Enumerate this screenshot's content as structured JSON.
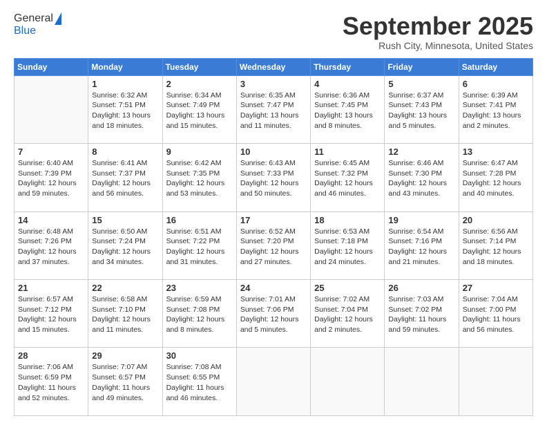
{
  "header": {
    "logo_general": "General",
    "logo_blue": "Blue",
    "month": "September 2025",
    "location": "Rush City, Minnesota, United States"
  },
  "days_of_week": [
    "Sunday",
    "Monday",
    "Tuesday",
    "Wednesday",
    "Thursday",
    "Friday",
    "Saturday"
  ],
  "weeks": [
    [
      {
        "day": "",
        "info": ""
      },
      {
        "day": "1",
        "info": "Sunrise: 6:32 AM\nSunset: 7:51 PM\nDaylight: 13 hours\nand 18 minutes."
      },
      {
        "day": "2",
        "info": "Sunrise: 6:34 AM\nSunset: 7:49 PM\nDaylight: 13 hours\nand 15 minutes."
      },
      {
        "day": "3",
        "info": "Sunrise: 6:35 AM\nSunset: 7:47 PM\nDaylight: 13 hours\nand 11 minutes."
      },
      {
        "day": "4",
        "info": "Sunrise: 6:36 AM\nSunset: 7:45 PM\nDaylight: 13 hours\nand 8 minutes."
      },
      {
        "day": "5",
        "info": "Sunrise: 6:37 AM\nSunset: 7:43 PM\nDaylight: 13 hours\nand 5 minutes."
      },
      {
        "day": "6",
        "info": "Sunrise: 6:39 AM\nSunset: 7:41 PM\nDaylight: 13 hours\nand 2 minutes."
      }
    ],
    [
      {
        "day": "7",
        "info": "Sunrise: 6:40 AM\nSunset: 7:39 PM\nDaylight: 12 hours\nand 59 minutes."
      },
      {
        "day": "8",
        "info": "Sunrise: 6:41 AM\nSunset: 7:37 PM\nDaylight: 12 hours\nand 56 minutes."
      },
      {
        "day": "9",
        "info": "Sunrise: 6:42 AM\nSunset: 7:35 PM\nDaylight: 12 hours\nand 53 minutes."
      },
      {
        "day": "10",
        "info": "Sunrise: 6:43 AM\nSunset: 7:33 PM\nDaylight: 12 hours\nand 50 minutes."
      },
      {
        "day": "11",
        "info": "Sunrise: 6:45 AM\nSunset: 7:32 PM\nDaylight: 12 hours\nand 46 minutes."
      },
      {
        "day": "12",
        "info": "Sunrise: 6:46 AM\nSunset: 7:30 PM\nDaylight: 12 hours\nand 43 minutes."
      },
      {
        "day": "13",
        "info": "Sunrise: 6:47 AM\nSunset: 7:28 PM\nDaylight: 12 hours\nand 40 minutes."
      }
    ],
    [
      {
        "day": "14",
        "info": "Sunrise: 6:48 AM\nSunset: 7:26 PM\nDaylight: 12 hours\nand 37 minutes."
      },
      {
        "day": "15",
        "info": "Sunrise: 6:50 AM\nSunset: 7:24 PM\nDaylight: 12 hours\nand 34 minutes."
      },
      {
        "day": "16",
        "info": "Sunrise: 6:51 AM\nSunset: 7:22 PM\nDaylight: 12 hours\nand 31 minutes."
      },
      {
        "day": "17",
        "info": "Sunrise: 6:52 AM\nSunset: 7:20 PM\nDaylight: 12 hours\nand 27 minutes."
      },
      {
        "day": "18",
        "info": "Sunrise: 6:53 AM\nSunset: 7:18 PM\nDaylight: 12 hours\nand 24 minutes."
      },
      {
        "day": "19",
        "info": "Sunrise: 6:54 AM\nSunset: 7:16 PM\nDaylight: 12 hours\nand 21 minutes."
      },
      {
        "day": "20",
        "info": "Sunrise: 6:56 AM\nSunset: 7:14 PM\nDaylight: 12 hours\nand 18 minutes."
      }
    ],
    [
      {
        "day": "21",
        "info": "Sunrise: 6:57 AM\nSunset: 7:12 PM\nDaylight: 12 hours\nand 15 minutes."
      },
      {
        "day": "22",
        "info": "Sunrise: 6:58 AM\nSunset: 7:10 PM\nDaylight: 12 hours\nand 11 minutes."
      },
      {
        "day": "23",
        "info": "Sunrise: 6:59 AM\nSunset: 7:08 PM\nDaylight: 12 hours\nand 8 minutes."
      },
      {
        "day": "24",
        "info": "Sunrise: 7:01 AM\nSunset: 7:06 PM\nDaylight: 12 hours\nand 5 minutes."
      },
      {
        "day": "25",
        "info": "Sunrise: 7:02 AM\nSunset: 7:04 PM\nDaylight: 12 hours\nand 2 minutes."
      },
      {
        "day": "26",
        "info": "Sunrise: 7:03 AM\nSunset: 7:02 PM\nDaylight: 11 hours\nand 59 minutes."
      },
      {
        "day": "27",
        "info": "Sunrise: 7:04 AM\nSunset: 7:00 PM\nDaylight: 11 hours\nand 56 minutes."
      }
    ],
    [
      {
        "day": "28",
        "info": "Sunrise: 7:06 AM\nSunset: 6:59 PM\nDaylight: 11 hours\nand 52 minutes."
      },
      {
        "day": "29",
        "info": "Sunrise: 7:07 AM\nSunset: 6:57 PM\nDaylight: 11 hours\nand 49 minutes."
      },
      {
        "day": "30",
        "info": "Sunrise: 7:08 AM\nSunset: 6:55 PM\nDaylight: 11 hours\nand 46 minutes."
      },
      {
        "day": "",
        "info": ""
      },
      {
        "day": "",
        "info": ""
      },
      {
        "day": "",
        "info": ""
      },
      {
        "day": "",
        "info": ""
      }
    ]
  ]
}
